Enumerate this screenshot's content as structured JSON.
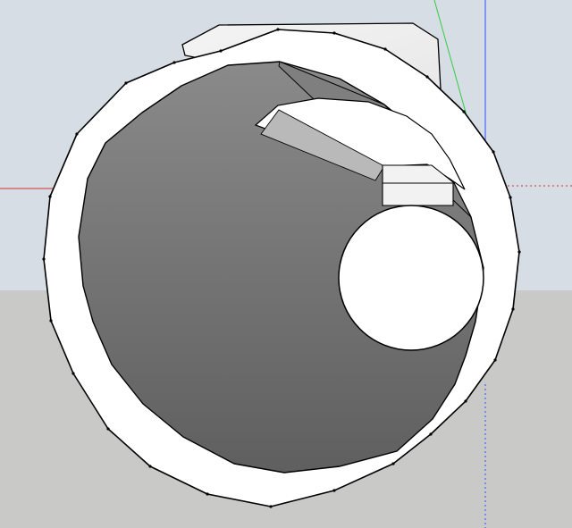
{
  "app": {
    "kind": "3d-modeling-viewport"
  },
  "scene": {
    "sky_color": "#d7dde4",
    "ground_color": "#c9c9c7",
    "edge_color": "#000000",
    "face_white": "#ffffff",
    "face_light_gray": "#ececec",
    "inner_dark_gray": "#6f6f6f"
  },
  "axes": {
    "red_color": "#d32f2f",
    "green_color": "#2ecc40",
    "blue_color": "#2e4dff"
  }
}
